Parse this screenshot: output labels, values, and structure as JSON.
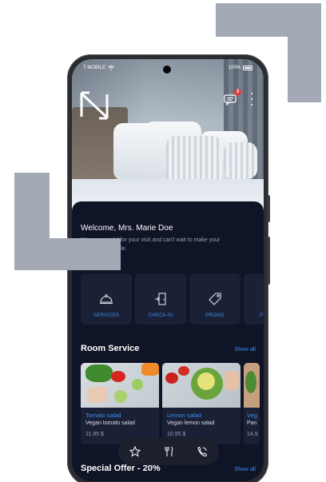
{
  "status_bar": {
    "carrier": "T-MOBILE",
    "battery": "100%"
  },
  "header": {
    "logo": "N-logo",
    "message_badge": "3"
  },
  "welcome": {
    "title": "Welcome, Mrs. Marie Doe",
    "subtitle": "We are grateful for your visit and can't wait to make your stay unforgettable."
  },
  "services": [
    {
      "label": "SERVICES",
      "icon": "cloche-icon"
    },
    {
      "label": "CHECK-IN",
      "icon": "door-icon"
    },
    {
      "label": "PROMO",
      "icon": "tag-icon"
    },
    {
      "label": "P",
      "icon": "partial-icon"
    }
  ],
  "room_service": {
    "title": "Room Service",
    "show_all": "Show all",
    "items": [
      {
        "name": "Tomato salad",
        "desc": "Vegan tomato salad",
        "price": "11.95 $"
      },
      {
        "name": "Lemon salad",
        "desc": "Vegan lemon salad",
        "price": "10.95 $"
      },
      {
        "name": "Veg",
        "desc": "Pan",
        "price": "14.9"
      }
    ]
  },
  "special_offer": {
    "title": "Special Offer - 20%",
    "show_all": "Show all"
  },
  "bottom_nav": [
    {
      "icon": "star-icon"
    },
    {
      "icon": "fork-knife-icon"
    },
    {
      "icon": "phone-icon"
    }
  ],
  "colors": {
    "accent": "#3d8ff0",
    "panel": "#0f1426",
    "tile": "#1a2036",
    "badge": "#e33b3b",
    "deco": "#a4a9b6"
  }
}
